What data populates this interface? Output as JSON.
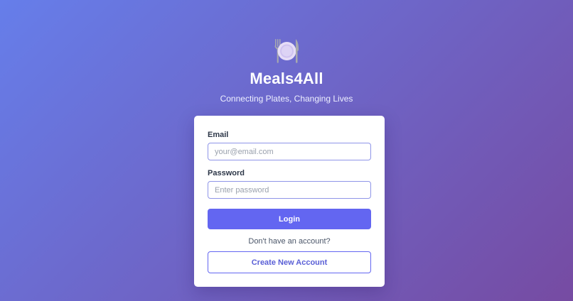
{
  "app": {
    "title": "Meals4All",
    "tagline": "Connecting Plates, Changing Lives",
    "logo_icon": "plate-with-cutlery-icon"
  },
  "login_form": {
    "email_label": "Email",
    "email_placeholder": "your@email.com",
    "email_value": "",
    "password_label": "Password",
    "password_placeholder": "Enter password",
    "password_value": "",
    "login_label": "Login",
    "signup_prompt": "Don't have an account?",
    "create_account_label": "Create New Account"
  },
  "colors": {
    "gradient_start": "#667eea",
    "gradient_end": "#764ba2",
    "primary": "#6366f1",
    "card_background": "#ffffff"
  }
}
